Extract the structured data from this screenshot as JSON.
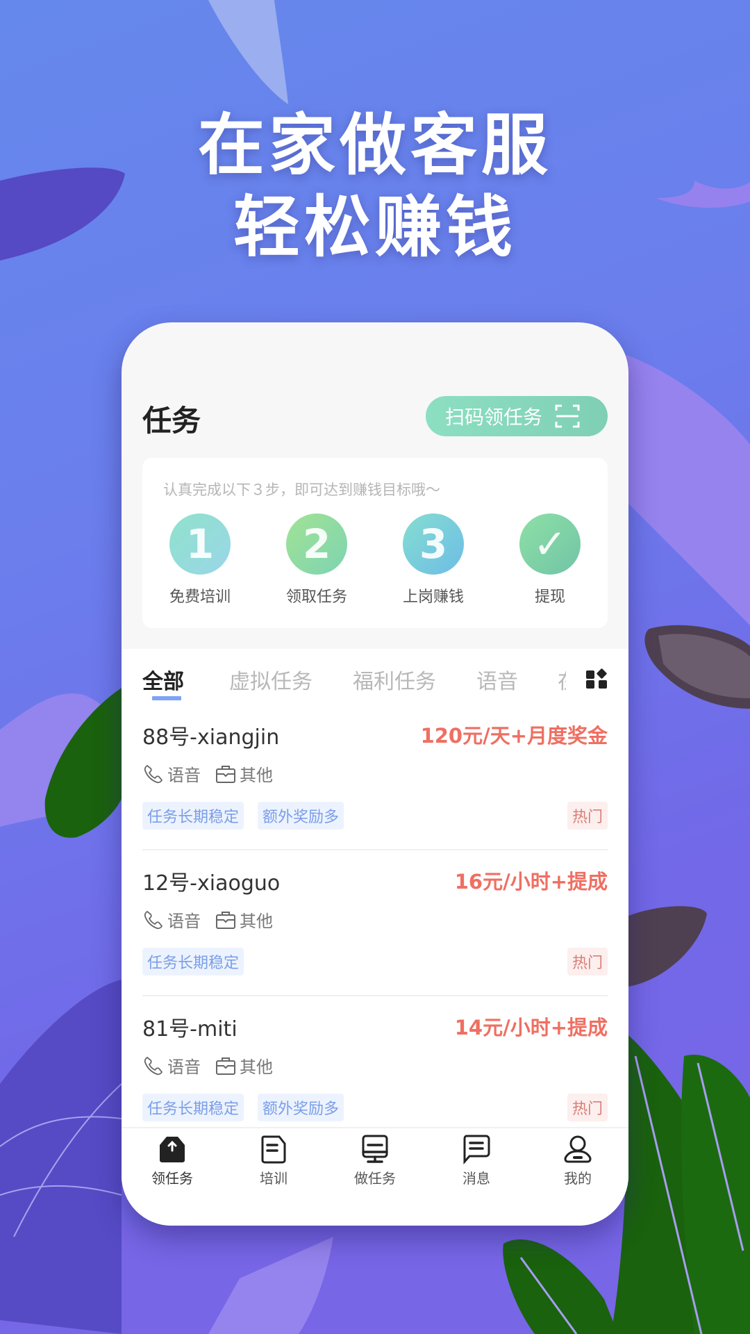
{
  "headline": {
    "line1": "在家做客服",
    "line2": "轻松赚钱"
  },
  "app": {
    "title": "任务",
    "scan_button": {
      "label": "扫码领任务",
      "icon": "scan-icon"
    },
    "accent_color": "#7ea2f6",
    "pay_color": "#ef6f62"
  },
  "steps": {
    "hint": "认真完成以下３步，即可达到赚钱目标哦～",
    "items": [
      {
        "number": "1",
        "label": "免费培训",
        "colors": [
          "#8fe2cb",
          "#9ad6e8"
        ]
      },
      {
        "number": "2",
        "label": "领取任务",
        "colors": [
          "#a2e394",
          "#7dd3b2"
        ]
      },
      {
        "number": "3",
        "label": "上岗赚钱",
        "colors": [
          "#84ddd0",
          "#6ebde6"
        ]
      },
      {
        "number": "✓",
        "label": "提现",
        "colors": [
          "#8de0a6",
          "#72c4a7"
        ]
      }
    ]
  },
  "tabs": {
    "items": [
      {
        "label": "全部",
        "active": true
      },
      {
        "label": "虚拟任务",
        "active": false
      },
      {
        "label": "福利任务",
        "active": false
      },
      {
        "label": "语音",
        "active": false
      },
      {
        "label": "在",
        "active": false
      }
    ],
    "more_icon": "grid-icon"
  },
  "jobs": [
    {
      "name": "88号-xiangjin",
      "pay": "120元/天+月度奖金",
      "type": "语音",
      "category": "其他",
      "tags": [
        "任务长期稳定",
        "额外奖励多"
      ],
      "badge": "热门"
    },
    {
      "name": "12号-xiaoguo",
      "pay": "16元/小时+提成",
      "type": "语音",
      "category": "其他",
      "tags": [
        "任务长期稳定"
      ],
      "badge": "热门"
    },
    {
      "name": "81号-miti",
      "pay": "14元/小时+提成",
      "type": "语音",
      "category": "其他",
      "tags": [
        "任务长期稳定",
        "额外奖励多"
      ],
      "badge": "热门"
    }
  ],
  "tabbar": {
    "items": [
      {
        "label": "领任务",
        "icon": "receive-task-icon",
        "active": true
      },
      {
        "label": "培训",
        "icon": "training-icon",
        "active": false
      },
      {
        "label": "做任务",
        "icon": "do-task-icon",
        "active": false
      },
      {
        "label": "消息",
        "icon": "message-icon",
        "active": false
      },
      {
        "label": "我的",
        "icon": "profile-icon",
        "active": false
      }
    ]
  }
}
